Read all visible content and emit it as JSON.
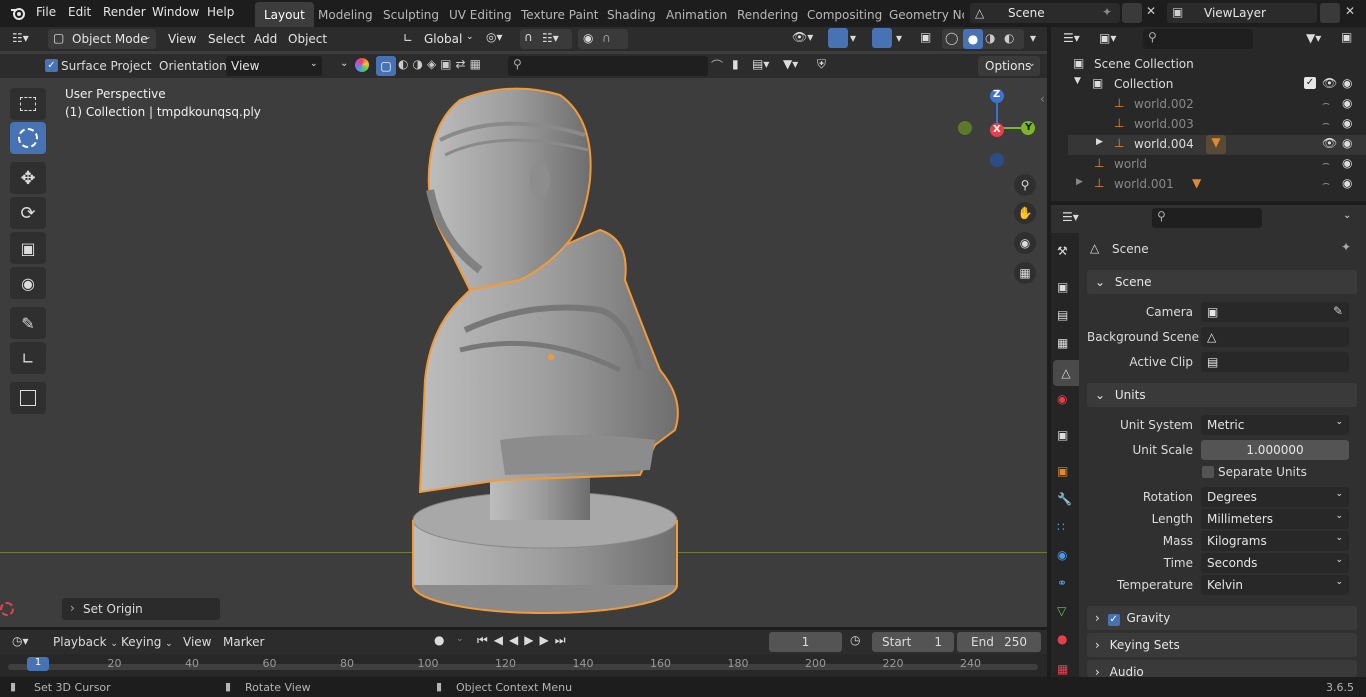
{
  "topmenu": {
    "items": [
      "File",
      "Edit",
      "Render",
      "Window",
      "Help"
    ],
    "workspaces": [
      "Layout",
      "Modeling",
      "Sculpting",
      "UV Editing",
      "Texture Paint",
      "Shading",
      "Animation",
      "Rendering",
      "Compositing",
      "Geometry Noc"
    ],
    "scene": "Scene",
    "view_layer": "ViewLayer"
  },
  "viewport_header": {
    "mode": "Object Mode",
    "menus": [
      "View",
      "Select",
      "Add",
      "Object"
    ],
    "transform": "Global",
    "surface_project": "Surface Project",
    "orientation_label": "Orientation:",
    "orientation_value": "View",
    "options": "Options"
  },
  "viewport": {
    "perspective": "User Perspective",
    "collection_info": "(1) Collection | tmpdkounqsq.ply",
    "last_op": "Set Origin",
    "gizmo": {
      "z": "Z",
      "y": "Y",
      "x": "X"
    }
  },
  "outliner": {
    "root": "Scene Collection",
    "items": [
      {
        "label": "Collection",
        "depth": 0
      },
      {
        "label": "world.002",
        "depth": 1
      },
      {
        "label": "world.003",
        "depth": 1
      },
      {
        "label": "world.004",
        "depth": 1
      },
      {
        "label": "world",
        "depth": 0
      },
      {
        "label": "world.001",
        "depth": 0
      }
    ]
  },
  "properties": {
    "context": "Scene",
    "scene_section": "Scene",
    "camera_label": "Camera",
    "bg_scene_label": "Background Scene",
    "active_clip_label": "Active Clip",
    "units_section": "Units",
    "unit_system_label": "Unit System",
    "unit_system": "Metric",
    "unit_scale_label": "Unit Scale",
    "unit_scale": "1.000000",
    "separate_units": "Separate Units",
    "rotation_label": "Rotation",
    "rotation": "Degrees",
    "length_label": "Length",
    "length": "Millimeters",
    "mass_label": "Mass",
    "mass": "Kilograms",
    "time_label": "Time",
    "time": "Seconds",
    "temperature_label": "Temperature",
    "temperature": "Kelvin",
    "gravity": "Gravity",
    "keying_sets": "Keying Sets",
    "audio": "Audio"
  },
  "timeline": {
    "playback": "Playback",
    "keying": "Keying",
    "view": "View",
    "marker": "Marker",
    "current_frame": "1",
    "start_label": "Start",
    "start": "1",
    "end_label": "End",
    "end": "250",
    "ticks": [
      "1",
      "20",
      "40",
      "60",
      "80",
      "100",
      "120",
      "140",
      "160",
      "180",
      "200",
      "220",
      "240"
    ]
  },
  "status": {
    "left": "Set 3D Cursor",
    "middle": "Rotate View",
    "right": "Object Context Menu",
    "version": "3.6.5"
  },
  "colors": {
    "accent": "#4772b3",
    "selection": "#f29a38",
    "x_axis": "#e5404d",
    "y_axis": "#7db52c",
    "z_axis": "#3d73cc"
  }
}
